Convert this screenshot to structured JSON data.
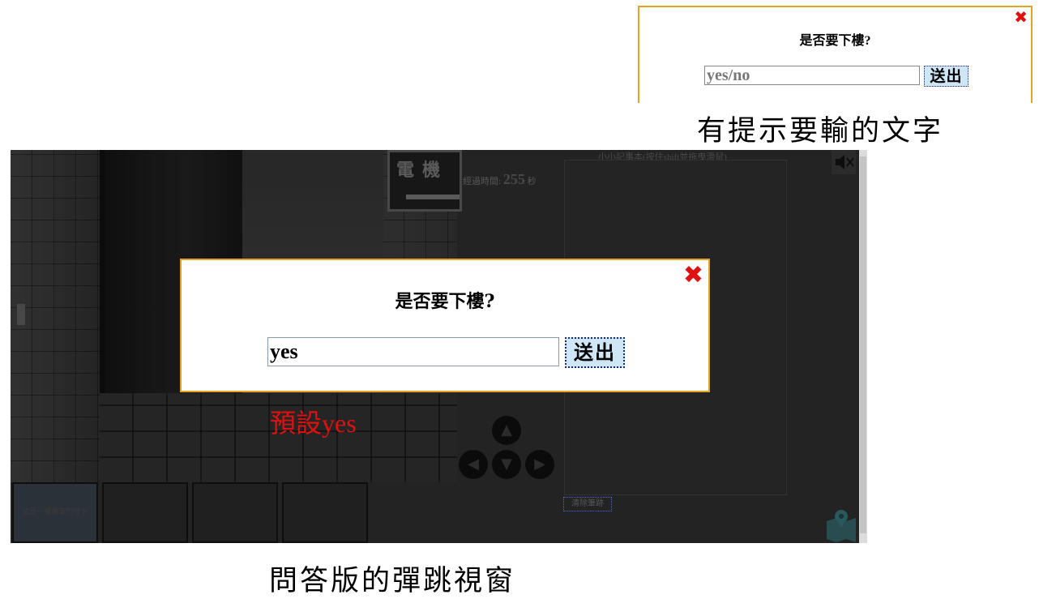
{
  "example_dialog": {
    "question": "是否要下樓?",
    "input_placeholder": "yes/no",
    "submit_label": "送出",
    "close_glyph": "✖"
  },
  "caption_top": "有提示要輸的文字",
  "game": {
    "elevator_sign": "電機",
    "timer": {
      "label": "經過時間:",
      "value": "255",
      "unit": "秒"
    },
    "notepad_title": "小小記事本(按住shift並拖曳滑鼠)",
    "clear_button": "清除筆跡",
    "inventory": [
      "這是一樓教室門號卡",
      "",
      "",
      ""
    ],
    "arrows": {
      "up": "▲",
      "left": "◀",
      "down": "▼",
      "right": "▶"
    }
  },
  "dialog": {
    "question": "是否要下樓?",
    "input_value": "yes",
    "submit_label": "送出",
    "close_glyph": "✖"
  },
  "default_note": "預設yes",
  "caption_bottom": "問答版的彈跳視窗",
  "colors": {
    "accent_border": "#e5a323",
    "close_red": "#e01010",
    "button_bg": "#cfe6f7"
  }
}
